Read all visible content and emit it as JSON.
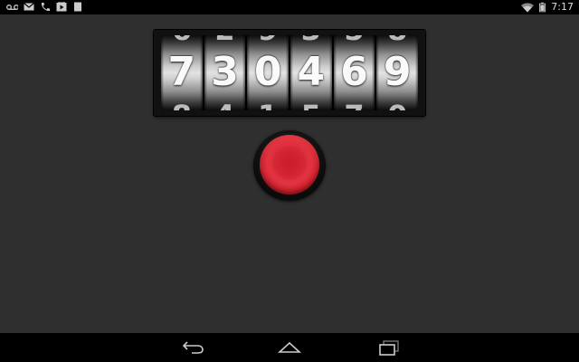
{
  "status_bar": {
    "left_icons": [
      "voicemail-icon",
      "gmail-icon",
      "phone-icon",
      "play-store-icon",
      "sd-card-icon"
    ],
    "right_icons": [
      "wifi-icon",
      "battery-icon"
    ],
    "time": "7:17"
  },
  "counter": {
    "digits": [
      "7",
      "3",
      "0",
      "4",
      "6",
      "9"
    ]
  },
  "button": {
    "color": "#d8222e"
  },
  "nav_bar": {
    "buttons": [
      "back-icon",
      "home-icon",
      "recents-icon"
    ]
  }
}
